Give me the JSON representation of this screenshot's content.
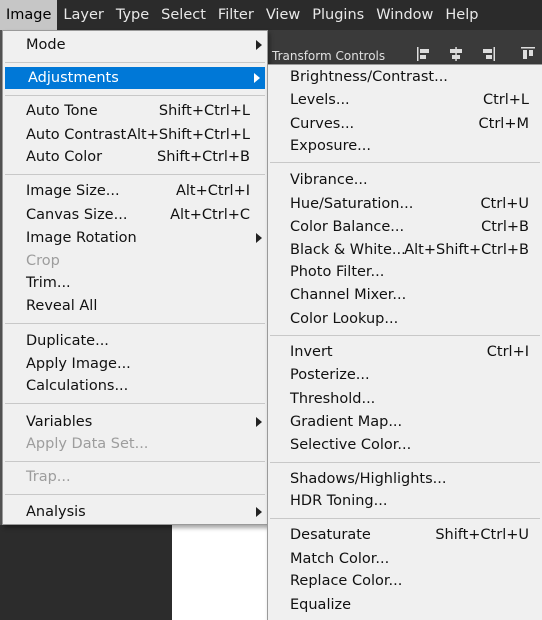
{
  "menubar": [
    "Image",
    "Layer",
    "Type",
    "Select",
    "Filter",
    "View",
    "Plugins",
    "Window",
    "Help"
  ],
  "options_bar": {
    "label": "Transform Controls"
  },
  "image_menu": {
    "mode": "Mode",
    "adjustments": "Adjustments",
    "auto_tone": {
      "label": "Auto Tone",
      "shortcut": "Shift+Ctrl+L"
    },
    "auto_contrast": {
      "label": "Auto Contrast",
      "shortcut": "Alt+Shift+Ctrl+L"
    },
    "auto_color": {
      "label": "Auto Color",
      "shortcut": "Shift+Ctrl+B"
    },
    "image_size": {
      "label": "Image Size...",
      "shortcut": "Alt+Ctrl+I"
    },
    "canvas_size": {
      "label": "Canvas Size...",
      "shortcut": "Alt+Ctrl+C"
    },
    "image_rotation": "Image Rotation",
    "crop": "Crop",
    "trim": "Trim...",
    "reveal_all": "Reveal All",
    "duplicate": "Duplicate...",
    "apply_image": "Apply Image...",
    "calculations": "Calculations...",
    "variables": "Variables",
    "apply_data_set": "Apply Data Set...",
    "trap": "Trap...",
    "analysis": "Analysis"
  },
  "adjustments_menu": {
    "brightness_contrast": {
      "label": "Brightness/Contrast...",
      "shortcut": ""
    },
    "levels": {
      "label": "Levels...",
      "shortcut": "Ctrl+L"
    },
    "curves": {
      "label": "Curves...",
      "shortcut": "Ctrl+M"
    },
    "exposure": {
      "label": "Exposure...",
      "shortcut": ""
    },
    "vibrance": {
      "label": "Vibrance...",
      "shortcut": ""
    },
    "hue_saturation": {
      "label": "Hue/Saturation...",
      "shortcut": "Ctrl+U"
    },
    "color_balance": {
      "label": "Color Balance...",
      "shortcut": "Ctrl+B"
    },
    "black_white": {
      "label": "Black & White...",
      "shortcut": "Alt+Shift+Ctrl+B"
    },
    "photo_filter": {
      "label": "Photo Filter...",
      "shortcut": ""
    },
    "channel_mixer": {
      "label": "Channel Mixer...",
      "shortcut": ""
    },
    "color_lookup": {
      "label": "Color Lookup...",
      "shortcut": ""
    },
    "invert": {
      "label": "Invert",
      "shortcut": "Ctrl+I"
    },
    "posterize": {
      "label": "Posterize...",
      "shortcut": ""
    },
    "threshold": {
      "label": "Threshold...",
      "shortcut": ""
    },
    "gradient_map": {
      "label": "Gradient Map...",
      "shortcut": ""
    },
    "selective_color": {
      "label": "Selective Color...",
      "shortcut": ""
    },
    "shadows_highlights": {
      "label": "Shadows/Highlights...",
      "shortcut": ""
    },
    "hdr_toning": {
      "label": "HDR Toning...",
      "shortcut": ""
    },
    "desaturate": {
      "label": "Desaturate",
      "shortcut": "Shift+Ctrl+U"
    },
    "match_color": {
      "label": "Match Color...",
      "shortcut": ""
    },
    "replace_color": {
      "label": "Replace Color...",
      "shortcut": ""
    },
    "equalize": {
      "label": "Equalize",
      "shortcut": ""
    }
  },
  "colors": {
    "highlight": "#0078d7",
    "menubar": "#2b2b2b",
    "menu_bg": "#f0f0f0",
    "disabled": "#9d9d9d"
  }
}
